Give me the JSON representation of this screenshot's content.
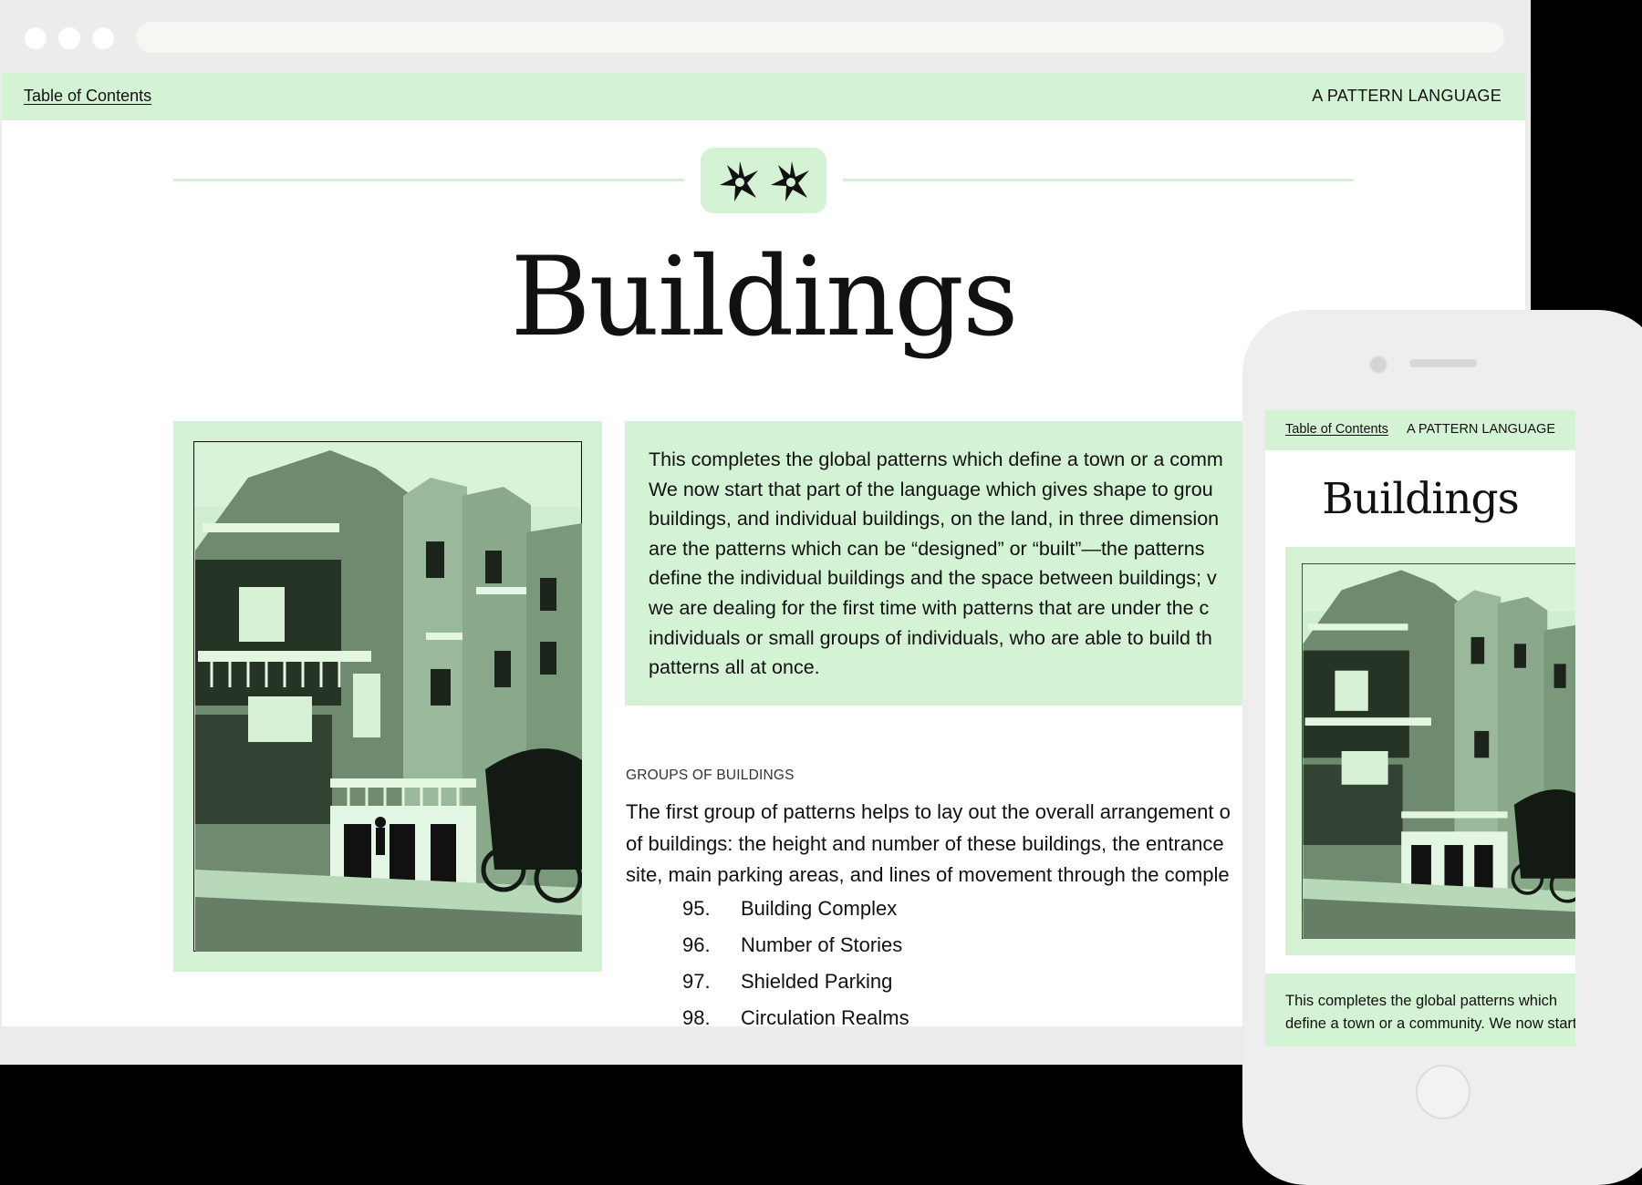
{
  "desktop": {
    "nav": {
      "toc_link": "Table of Contents",
      "brand": "A PATTERN LANGUAGE"
    },
    "badge_icon": "two-asterisks-icon",
    "title": "Buildings",
    "intro_lines": [
      "This completes the global patterns which define a town or a comm",
      "We now start that part of the language which gives shape to grou",
      "buildings, and individual buildings, on the land, in three dimension",
      "are the patterns which can be “designed” or “built”—the patterns",
      "define the individual buildings and the space between buildings; v",
      "we are dealing for the first time with patterns that are under the c",
      "individuals or small groups of individuals, who are able to build th",
      "patterns all at once."
    ],
    "section_label": "GROUPS OF BUILDINGS",
    "section_lines": [
      "The first group of patterns helps to lay out the overall arrangement o",
      "of buildings: the height and number of these buildings, the entrance",
      "site, main parking areas, and lines of movement through the comple"
    ],
    "patterns": [
      {
        "num": "95.",
        "name": "Building Complex"
      },
      {
        "num": "96.",
        "name": "Number of Stories"
      },
      {
        "num": "97.",
        "name": "Shielded Parking"
      },
      {
        "num": "98.",
        "name": "Circulation Realms"
      }
    ]
  },
  "mobile": {
    "nav": {
      "toc_link": "Table of Contents",
      "brand": "A PATTERN LANGUAGE"
    },
    "title": "Buildings",
    "intro_lines": [
      "This completes the global patterns which",
      "define a town or a community. We now start"
    ]
  },
  "colors": {
    "accent_green": "#d4f2d4",
    "text": "#111111",
    "browser_chrome": "#ececec"
  }
}
